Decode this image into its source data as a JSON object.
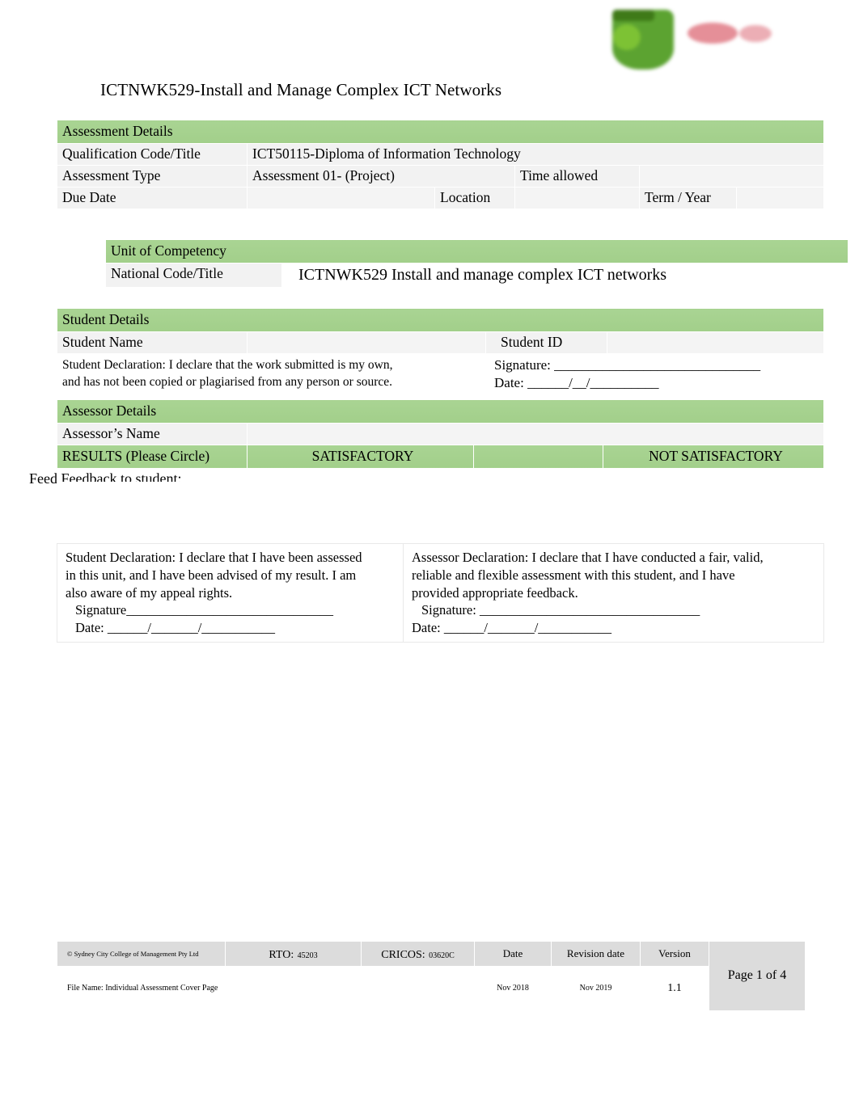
{
  "document": {
    "title": "ICTNWK529-Install and Manage Complex ICT Networks"
  },
  "logo": {
    "shield_color": "#4e9b1f",
    "text_color": "#e07b86"
  },
  "assessment_details": {
    "section_heading": "Assessment Details",
    "qualification_label": "Qualification Code/Title",
    "qualification_value": "ICT50115-Diploma of Information Technology",
    "assessment_type_label": "Assessment Type",
    "assessment_type_value": "Assessment 01- (Project)",
    "time_allowed_label": "Time allowed",
    "time_allowed_value": "",
    "due_date_label": "Due Date",
    "due_date_value": "",
    "location_label": "Location",
    "location_value": "",
    "term_year_label": "Term / Year",
    "term_year_value": ""
  },
  "unit_of_competency": {
    "section_heading": "Unit of Competency",
    "national_code_label": "National Code/Title",
    "national_code_value": "ICTNWK529 Install and manage complex ICT networks"
  },
  "student_details": {
    "section_heading": "Student Details",
    "student_name_label": "Student Name",
    "student_name_value": "",
    "student_id_label": "Student ID",
    "student_id_value": "",
    "declaration_line1": "Student Declaration:   I declare that the work submitted is my own,",
    "declaration_line2": "and has not been copied or plagiarised from any person or source.",
    "signature_label": "Signature: ______________________________",
    "date_label": "Date:          ______/__/__________"
  },
  "assessor_details": {
    "section_heading": "Assessor Details",
    "assessor_name_label": "Assessor’s Name",
    "assessor_name_value": "",
    "results_label": "RESULTS (Please Circle)",
    "result_satisfactory": "SATISFACTORY",
    "result_not_satisfactory": "NOT SATISFACTORY"
  },
  "feedback": {
    "label": "Feed Feedback to student:",
    "value": ""
  },
  "declarations": {
    "student": {
      "line1": "Student Declaration:   I declare that I have been assessed",
      "line2": "in this unit, and I have been advised of my result.   I am",
      "line3": "also aware of my appeal rights.",
      "signature": " Signature_______________________________",
      "date": " Date:             ______/_______/___________"
    },
    "assessor": {
      "line1": "Assessor Declaration:   I declare that I have conducted a fair, valid,",
      "line2": "reliable and flexible assessment with this student, and I have",
      "line3": "provided appropriate feedback.",
      "signature": " Signature:      _________________________________",
      "date": "Date:             ______/_______/___________"
    }
  },
  "footer": {
    "copyright": "© Sydney City College of Management Pty Ltd",
    "rto_label": "RTO:",
    "rto_value": "45203",
    "cricos_label": "CRICOS:",
    "cricos_value": "03620C",
    "date_header": "Date",
    "revision_header": "Revision date",
    "version_header": "Version",
    "file_name": "File Name: Individual Assessment Cover Page",
    "date_value": "Nov 2018",
    "revision_value": "Nov 2019",
    "version_value": "1.1",
    "page_indicator": "Page 1 of 4"
  }
}
